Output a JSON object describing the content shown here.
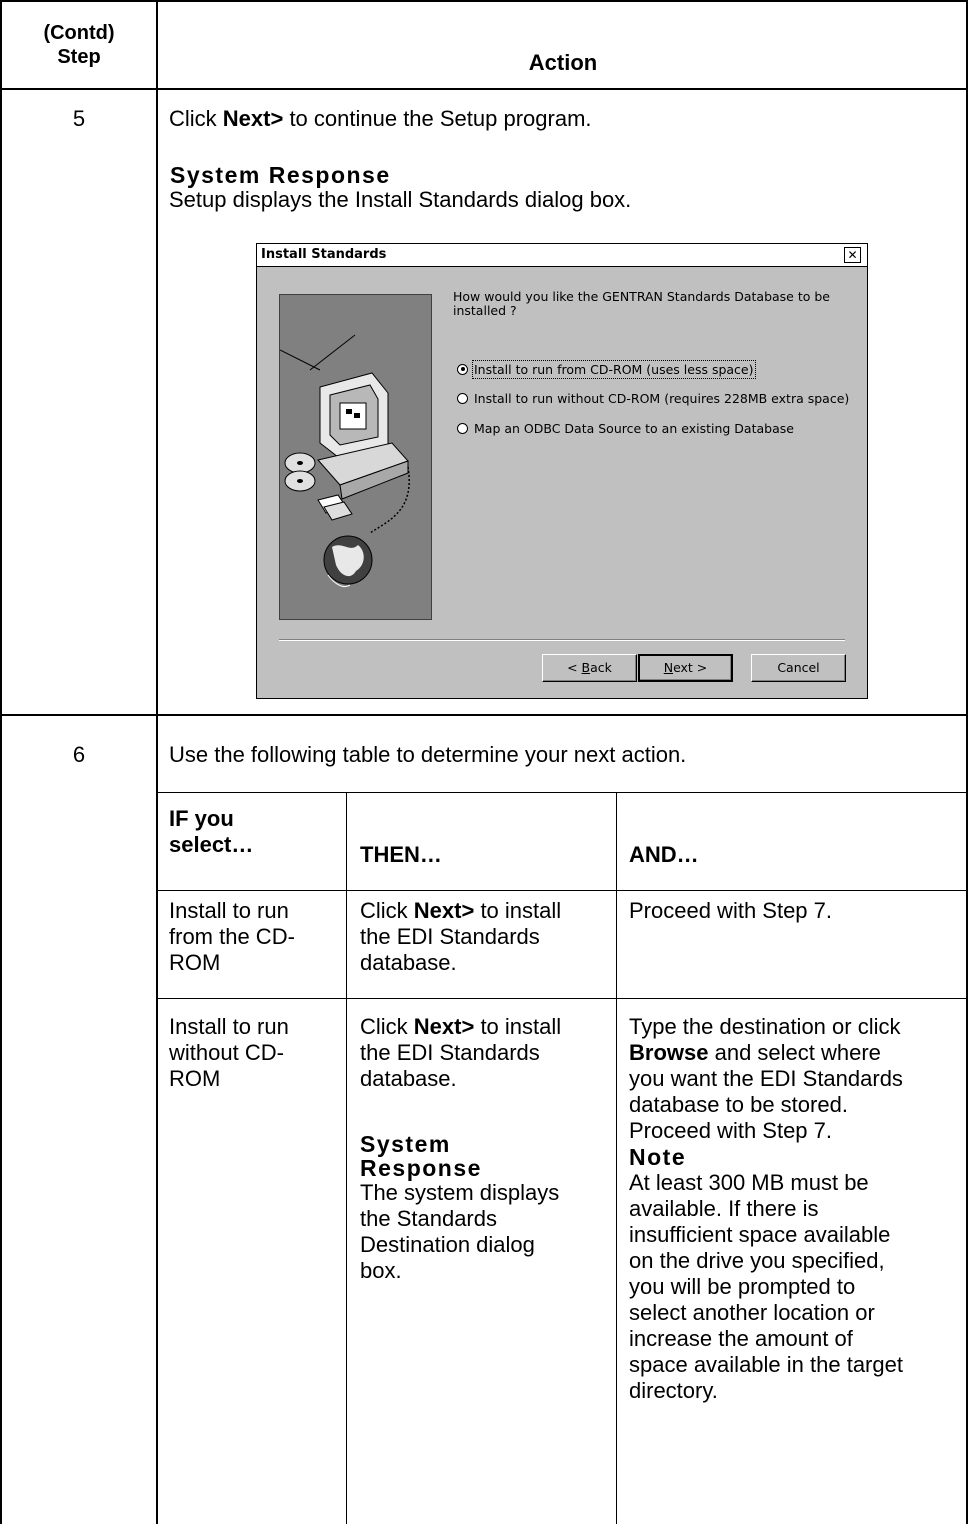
{
  "header": {
    "step_label": "(Contd)\nStep",
    "action_label": "Action"
  },
  "step5": {
    "number": "5",
    "text_pre": "Click ",
    "text_bold": "Next>",
    "text_post": " to continue the Setup program.",
    "response_heading": "System Response",
    "response_text": "Setup displays the Install Standards dialog box."
  },
  "dialog": {
    "title": "Install Standards",
    "close_glyph": "✕",
    "question": "How would you like the GENTRAN Standards Database to be installed ?",
    "options": [
      {
        "label": "Install to run from CD-ROM (uses less space)",
        "selected": true
      },
      {
        "label": "Install to run without CD-ROM (requires 228MB extra space)",
        "selected": false
      },
      {
        "label": "Map an ODBC Data Source to an existing Database",
        "selected": false
      }
    ],
    "back_prefix": "< ",
    "back_mnemonic": "B",
    "back_rest": "ack",
    "next_mnemonic": "N",
    "next_rest": "ext >",
    "cancel_label": "Cancel"
  },
  "step6": {
    "number": "6",
    "intro": "Use the following table to determine your next action.",
    "columns": [
      "IF you\nselect…",
      "THEN…",
      "AND…"
    ],
    "row1": {
      "if": "Install to run\nfrom the CD-\nROM",
      "then_pre": "Click ",
      "then_bold": "Next>",
      "then_post": " to install\nthe EDI Standards\ndatabase.",
      "and": "Proceed with Step 7."
    },
    "row2": {
      "if": "Install to run\nwithout CD-\nROM",
      "then_pre": "Click ",
      "then_bold": "Next>",
      "then_post": " to install\nthe EDI Standards\ndatabase.",
      "then_response_heading": "System\nResponse",
      "then_response_text": "The system displays\nthe Standards\nDestination dialog\nbox.",
      "and_pre": "Type the destination or click\n",
      "and_bold": "Browse",
      "and_post": " and select where\nyou want the EDI Standards\ndatabase to be stored.\nProceed with Step 7.",
      "note_heading": "Note",
      "note_text": "At least 300 MB must be\navailable. If there is\ninsufficient space available\non the drive you specified,\nyou will be prompted to\nselect another location or\nincrease the amount of\nspace available in the target\ndirectory."
    }
  }
}
